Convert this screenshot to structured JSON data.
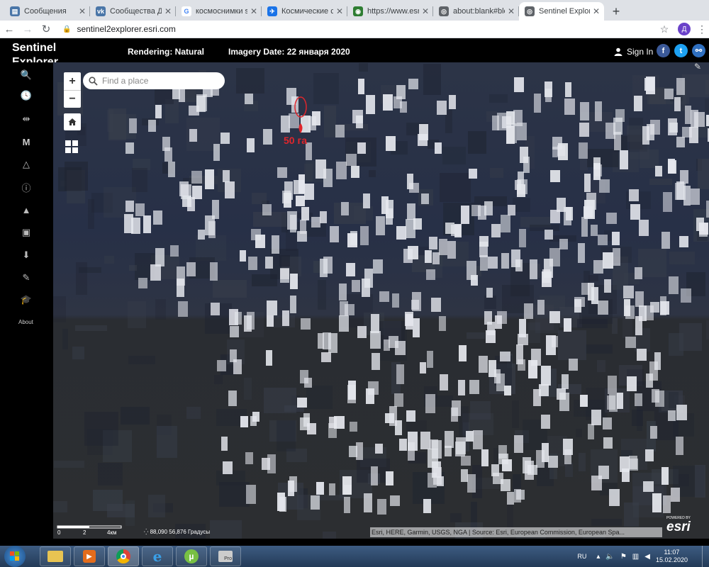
{
  "browser": {
    "tabs": [
      {
        "title": "Сообщения",
        "color": "#4a76a8",
        "glyph": "▤"
      },
      {
        "title": "Сообщества Дє",
        "color": "#4a76a8",
        "glyph": "vk"
      },
      {
        "title": "космоснимки sє",
        "color": "#ffffff",
        "glyph": "G"
      },
      {
        "title": "Космические сн",
        "color": "#1a73e8",
        "glyph": "✈"
      },
      {
        "title": "https://www.esri",
        "color": "#2e7d32",
        "glyph": "◉"
      },
      {
        "title": "about:blank#blo",
        "color": "#5f6368",
        "glyph": "◎"
      },
      {
        "title": "Sentinel Explorer",
        "color": "#5f6368",
        "glyph": "◎",
        "active": true
      }
    ],
    "url": "sentinel2explorer.esri.com",
    "profile_initial": "Д"
  },
  "app": {
    "logo": "Sentinel Explorer",
    "rendering": "Rendering: Natural",
    "imagery_date": "Imagery Date: 22 января 2020",
    "sign_in": "Sign In",
    "about": "About",
    "colors": {
      "facebook": "#3b5998",
      "twitter": "#1da1f2",
      "link": "#2f6fbf",
      "annotation": "#e0262c"
    }
  },
  "map": {
    "search_placeholder": "Find a place",
    "zoom_in": "+",
    "zoom_out": "−",
    "annotation": "50 га",
    "scale": {
      "zero": "0",
      "mid": "2",
      "end": "4км"
    },
    "coords": "88,090 56,876 Градусы",
    "attribution": "Esri, HERE, Garmin, USGS, NGA | Source: Esri, European Commission, European Spa...",
    "powered_by": "POWERED BY",
    "brand": "esri"
  },
  "taskbar": {
    "lang": "RU",
    "time": "11:07",
    "date": "15.02.2020",
    "apps": [
      "explorer",
      "media-player",
      "chrome",
      "internet-explorer",
      "utorrent",
      "pro-app"
    ]
  }
}
